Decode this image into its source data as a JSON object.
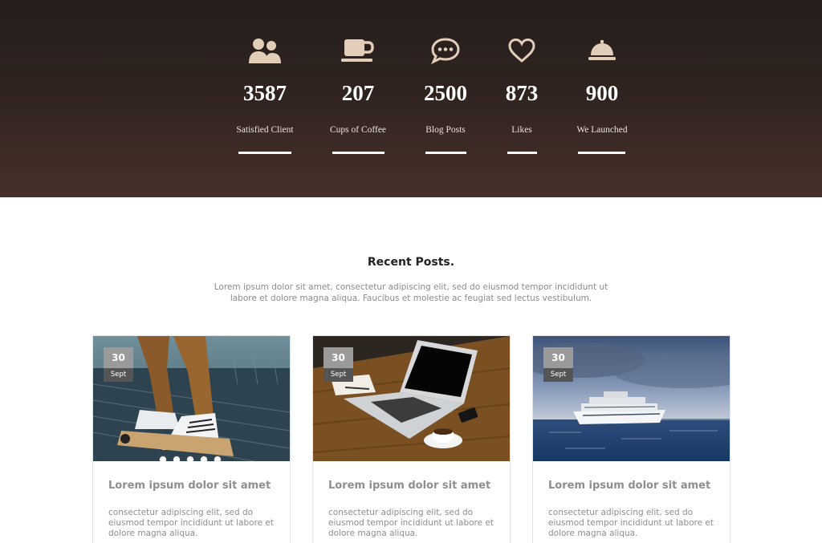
{
  "stats": [
    {
      "icon": "users-icon",
      "value": "3587",
      "label": "Satisfied Client"
    },
    {
      "icon": "coffee-cup-icon",
      "value": "207",
      "label": "Cups of Coffee"
    },
    {
      "icon": "chat-bubble-icon",
      "value": "2500",
      "label": "Blog Posts"
    },
    {
      "icon": "heart-icon",
      "value": "873",
      "label": "Likes"
    },
    {
      "icon": "service-bell-icon",
      "value": "900",
      "label": "We Launched"
    }
  ],
  "recent": {
    "title": "Recent Posts.",
    "intro": "Lorem ipsum dolor sit amet, consectetur adipiscing elit, sed do eiusmod tempor incididunt ut labore et dolore magna aliqua. Faucibus et molestie ac feugiat sed lectus vestibulum."
  },
  "posts": [
    {
      "day": "30",
      "month": "Sept",
      "title": "Lorem ipsum dolor sit amet",
      "excerpt": "consectetur adipiscing elit, sed do eiusmod tempor incididunt ut labore et dolore magna aliqua.",
      "image": "skateboard-sneakers-photo"
    },
    {
      "day": "30",
      "month": "Sept",
      "title": "Lorem ipsum dolor sit amet",
      "excerpt": "consectetur adipiscing elit, sed do eiusmod tempor incididunt ut labore et dolore magna aliqua.",
      "image": "laptop-coffee-photo"
    },
    {
      "day": "30",
      "month": "Sept",
      "title": "Lorem ipsum dolor sit amet",
      "excerpt": "consectetur adipiscing elit, sed do eiusmod tempor incididunt ut labore et dolore magna aliqua.",
      "image": "cruise-ship-photo"
    }
  ],
  "colors": {
    "icon": "#e2cdb8",
    "band_top": "#251e1d",
    "band_bottom": "#47302a",
    "text_muted": "#8e8e8e"
  }
}
